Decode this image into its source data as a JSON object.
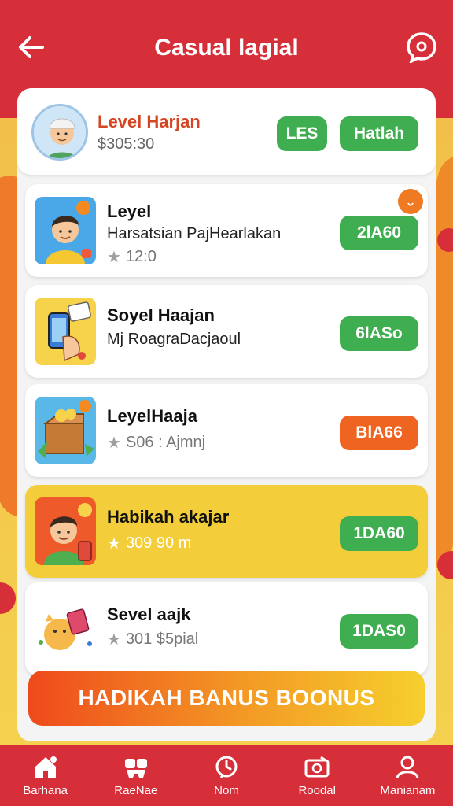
{
  "header": {
    "title": "Casual lagial"
  },
  "profile": {
    "name": "Level Harjan",
    "sub": "$305:30",
    "btn1": "LES",
    "btn2": "Hatlah"
  },
  "rows": [
    {
      "title": "Leyel",
      "sub": "Harsatsian PajHearlakan",
      "rating": "12:0",
      "button": "2lA60",
      "button_color": "green",
      "badge": "v"
    },
    {
      "title": "Soyel Haajan",
      "sub": "Mj RoagraDacjaoul",
      "rating": "",
      "button": "6lASo",
      "button_color": "green"
    },
    {
      "title": "LeyelHaaja",
      "sub": "",
      "rating": "S06 : Ajmnj",
      "button": "BlA66",
      "button_color": "orange"
    },
    {
      "title": "Habikah akajar",
      "sub": "",
      "rating": "309 90 m",
      "button": "1DA60",
      "button_color": "green"
    },
    {
      "title": "Sevel aajk",
      "sub": "",
      "rating": "301 $5pial",
      "button": "1DAS0",
      "button_color": "green"
    }
  ],
  "bonus_label": "HADIKAH BANUS BOONUS",
  "nav": [
    {
      "label": "Barhana",
      "icon": "home-icon"
    },
    {
      "label": "RaeNae",
      "icon": "games-icon"
    },
    {
      "label": "Nom",
      "icon": "clock-icon"
    },
    {
      "label": "Roodal",
      "icon": "wallet-icon"
    },
    {
      "label": "Manianam",
      "icon": "profile-icon"
    }
  ],
  "colors": {
    "primary_red": "#d62f3a",
    "green": "#3fae50",
    "orange": "#ef6420",
    "highlight_yellow": "#f4cd3a"
  }
}
